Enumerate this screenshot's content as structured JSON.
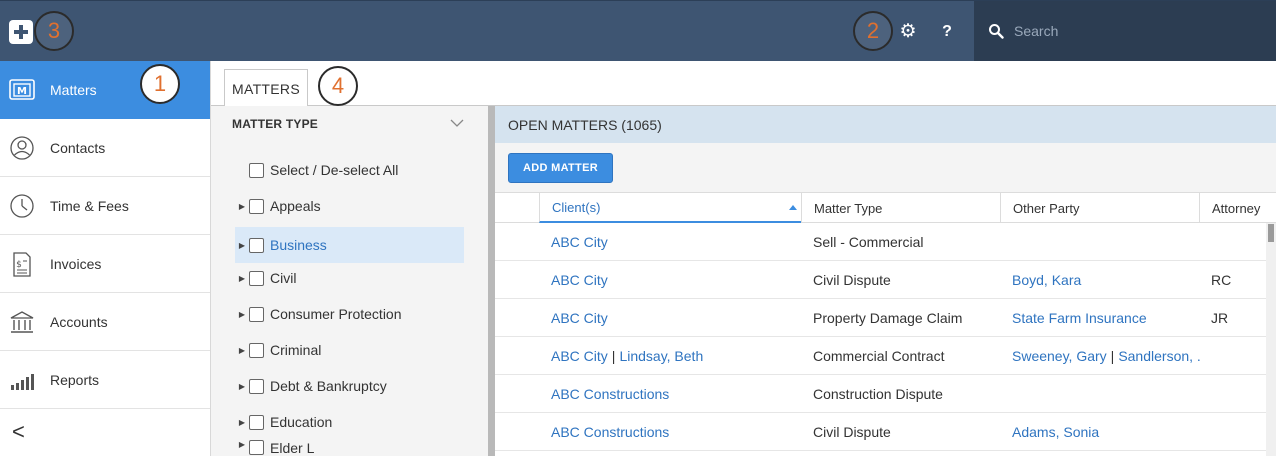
{
  "callouts": {
    "c1": "1",
    "c2": "2",
    "c3": "3",
    "c4": "4"
  },
  "header": {
    "search_placeholder": "Search",
    "help_label": "?"
  },
  "sidebar": {
    "items": [
      {
        "label": "Matters"
      },
      {
        "label": "Contacts"
      },
      {
        "label": "Time & Fees"
      },
      {
        "label": "Invoices"
      },
      {
        "label": "Accounts"
      },
      {
        "label": "Reports"
      }
    ],
    "collapse_label": "<"
  },
  "tabs": {
    "matters": "MATTERS"
  },
  "filter": {
    "title": "MATTER TYPE",
    "select_all": "Select / De-select All",
    "items": [
      "Appeals",
      "Business",
      "Civil",
      "Consumer Protection",
      "Criminal",
      "Debt & Bankruptcy",
      "Education",
      "Elder L"
    ]
  },
  "main": {
    "title": "OPEN MATTERS (1065)",
    "add_button": "ADD MATTER",
    "columns": [
      "Client(s)",
      "Matter Type",
      "Other Party",
      "Attorney"
    ],
    "rows": [
      {
        "client": "ABC City",
        "client2": "",
        "matter_type": "Sell - Commercial",
        "other": "",
        "other2": "",
        "attorney": ""
      },
      {
        "client": "ABC City",
        "client2": "",
        "matter_type": "Civil Dispute",
        "other": "Boyd, Kara",
        "other2": "",
        "attorney": "RC"
      },
      {
        "client": "ABC City",
        "client2": "",
        "matter_type": "Property Damage Claim",
        "other": "State Farm Insurance",
        "other2": "",
        "attorney": "JR"
      },
      {
        "client": "ABC City",
        "client2": "Lindsay, Beth",
        "matter_type": "Commercial Contract",
        "other": "Sweeney, Gary",
        "other2": "Sandlerson, ...",
        "attorney": ""
      },
      {
        "client": "ABC Constructions",
        "client2": "",
        "matter_type": "Construction Dispute",
        "other": "",
        "other2": "",
        "attorney": ""
      },
      {
        "client": "ABC Constructions",
        "client2": "",
        "matter_type": "Civil Dispute",
        "other": "Adams, Sonia",
        "other2": "",
        "attorney": ""
      }
    ]
  },
  "colors": {
    "accent": "#3c8de0",
    "topbar": "#3e5572",
    "link": "#2f74c0",
    "selected_row": "#dae9f8",
    "callout_number": "#e0702f"
  }
}
